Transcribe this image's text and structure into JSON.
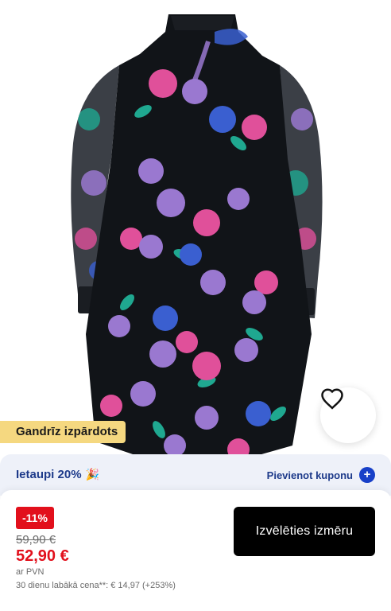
{
  "product": {
    "badge": "Gandrīz izpārdots",
    "wishlist_icon": "heart-icon"
  },
  "coupon": {
    "text": "Ietaupi 20%",
    "emoji": "🎉",
    "link": "Pievienot kuponu",
    "plus": "+"
  },
  "pricing": {
    "discount": "-11%",
    "old_price": "59,90 €",
    "new_price": "52,90 €",
    "vat": "ar PVN",
    "lowest_price": "30 dienu labākā cena**: € 14,97 (+253%)"
  },
  "actions": {
    "choose_size": "Izvēlēties izmēru"
  },
  "colors": {
    "dress_base": "#111418",
    "flower_pink": "#e0509a",
    "flower_purple": "#9a78d0",
    "flower_blue": "#3a5fd0",
    "leaf_teal": "#1fa890",
    "badge_yellow": "#f5d880",
    "sale_red": "#e2101c",
    "coupon_blue": "#1d3a8a"
  }
}
